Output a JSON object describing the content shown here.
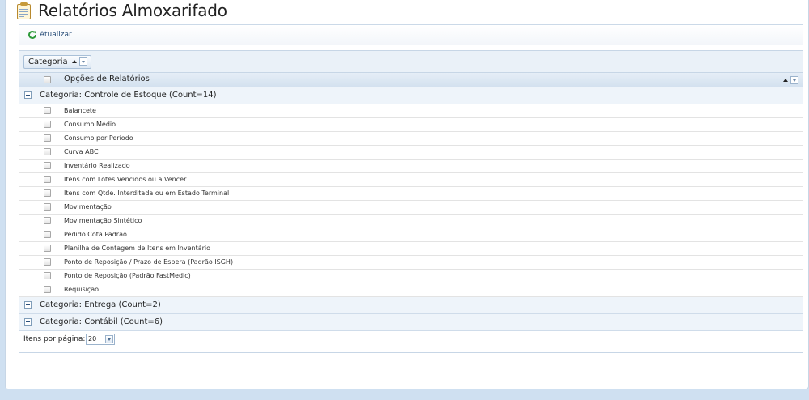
{
  "page": {
    "title": "Relatórios Almoxarifado"
  },
  "toolbar": {
    "refresh_label": "Atualizar"
  },
  "grid": {
    "group_panel": {
      "chip_label": "Categoria"
    },
    "header": {
      "column_label": "Opções de Relatórios"
    },
    "groups": [
      {
        "label": "Categoria: Controle de Estoque (Count=14)",
        "expanded": true,
        "items": [
          "Balancete",
          "Consumo Médio",
          "Consumo por Período",
          "Curva ABC",
          "Inventário Realizado",
          "Itens com Lotes Vencidos ou a Vencer",
          "Itens com Qtde. Interditada ou em Estado Terminal",
          "Movimentação",
          "Movimentação Sintético",
          "Pedido Cota Padrão",
          "Planilha de Contagem de Itens em Inventário",
          "Ponto de Reposição / Prazo de Espera (Padrão ISGH)",
          "Ponto de Reposição (Padrão FastMedic)",
          "Requisição"
        ]
      },
      {
        "label": "Categoria: Entrega (Count=2)",
        "expanded": false
      },
      {
        "label": "Categoria: Contábil (Count=6)",
        "expanded": false
      }
    ],
    "pager": {
      "label": "Itens por página:",
      "value": "20"
    }
  },
  "icons": {
    "title_icon": "report-document-icon",
    "refresh_icon": "refresh-icon",
    "collapse_icon": "minus-box-icon",
    "expand_icon": "plus-box-icon"
  },
  "colors": {
    "background": "#cfe0f1",
    "header": "#d3e1ef",
    "group_row": "#eef4fa",
    "refresh_green": "#2e9a3a"
  }
}
